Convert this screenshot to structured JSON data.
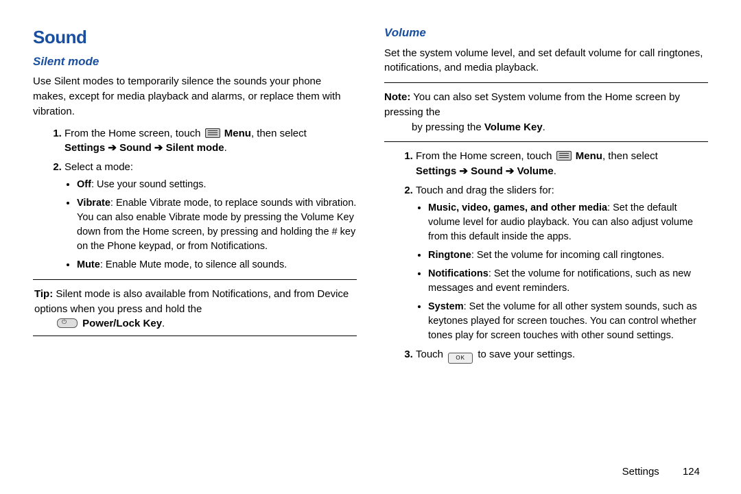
{
  "page": {
    "section_label": "Settings",
    "page_number": "124"
  },
  "left": {
    "h1": "Sound",
    "h2": "Silent mode",
    "intro": "Use Silent modes to temporarily silence the sounds your phone makes, except for media playback and alarms, or replace them with vibration.",
    "step1_a": "From the Home screen, touch ",
    "step1_menu": " Menu",
    "step1_b": ", then select ",
    "step1_path": "Settings ➔  Sound ➔  Silent mode",
    "step1_dot": ".",
    "step2": "Select a mode:",
    "bullets": {
      "off_b": "Off",
      "off_t": ": Use your sound settings.",
      "vib_b": "Vibrate",
      "vib_t": ": Enable Vibrate mode, to replace sounds with vibration. You can also enable Vibrate mode by pressing the Volume Key down from the Home screen, by pressing and holding the # key on the Phone keypad, or from Notifications.",
      "mute_b": "Mute",
      "mute_t": ": Enable Mute mode, to silence all sounds."
    },
    "tip_label": "Tip:",
    "tip_a": " Silent mode is also available from Notifications, and from Device options when you press and hold the ",
    "tip_key": " Power/Lock Key",
    "tip_dot": "."
  },
  "right": {
    "h2": "Volume",
    "intro": "Set the system volume level, and set default volume for call ringtones, notifications, and media playback.",
    "note_label": "Note:",
    "note_a": " You can also set System volume from the Home screen by pressing the ",
    "note_b": "Volume Key",
    "note_dot": ".",
    "step1_a": "From the Home screen, touch ",
    "step1_menu": " Menu",
    "step1_b": ", then select ",
    "step1_path": "Settings ➔  Sound ➔ Volume",
    "step1_dot": ".",
    "step2": "Touch and drag the sliders for:",
    "bullets": {
      "m_b": "Music, video, games, and other media",
      "m_t": ": Set the default volume level for audio playback. You can also adjust volume from this default inside the apps.",
      "r_b": "Ringtone",
      "r_t": ": Set the volume for incoming call ringtones.",
      "n_b": "Notifications",
      "n_t": ": Set the volume for notifications, such as new messages and event reminders.",
      "s_b": "System",
      "s_t": ": Set the volume for all other system sounds, such as keytones played for screen touches. You can control whether tones play for screen touches with other sound settings."
    },
    "step3_a": "Touch ",
    "step3_ok": "OK",
    "step3_b": " to save your settings."
  }
}
